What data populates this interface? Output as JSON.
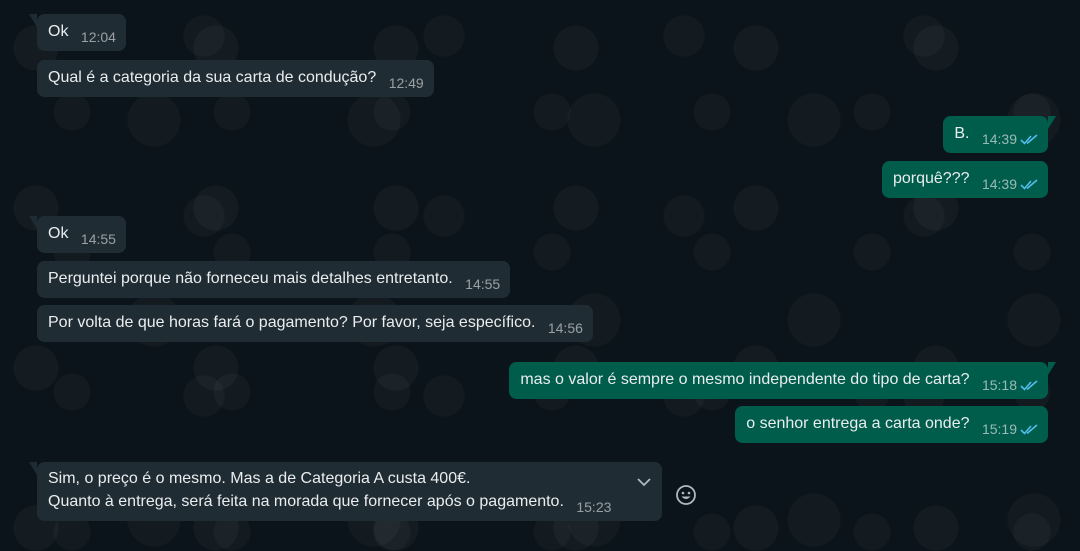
{
  "messages": [
    {
      "dir": "in",
      "text": "Ok",
      "time": "12:04"
    },
    {
      "dir": "in",
      "text": "Qual é a categoria da sua carta de condução?",
      "time": "12:49"
    },
    {
      "dir": "out",
      "text": "B.",
      "time": "14:39",
      "status": "read"
    },
    {
      "dir": "out",
      "text": "porquê???",
      "time": "14:39",
      "status": "read"
    },
    {
      "dir": "in",
      "text": "Ok",
      "time": "14:55"
    },
    {
      "dir": "in",
      "text": "Perguntei porque não forneceu mais detalhes entretanto.",
      "time": "14:55"
    },
    {
      "dir": "in",
      "text": "Por volta de que horas fará o pagamento? Por favor, seja específico.",
      "time": "14:56"
    },
    {
      "dir": "out",
      "text": "mas o valor é sempre o mesmo independente do tipo de carta?",
      "time": "15:18",
      "status": "read"
    },
    {
      "dir": "out",
      "text": "o senhor entrega a carta onde?",
      "time": "15:19",
      "status": "read"
    },
    {
      "dir": "in",
      "lines": [
        "Sim, o preço é o mesmo. Mas a de Categoria A custa 400€.",
        "Quanto à entrega, será feita na morada que fornecer após o pagamento."
      ],
      "time": "15:23"
    }
  ],
  "colors": {
    "background": "#0b141a",
    "incoming_bubble": "#202c33",
    "outgoing_bubble": "#005c4b",
    "read_ticks": "#53bdeb"
  },
  "icons": {
    "read_receipt": "double-check-icon",
    "message_menu": "chevron-down-icon",
    "react": "emoji-icon"
  }
}
